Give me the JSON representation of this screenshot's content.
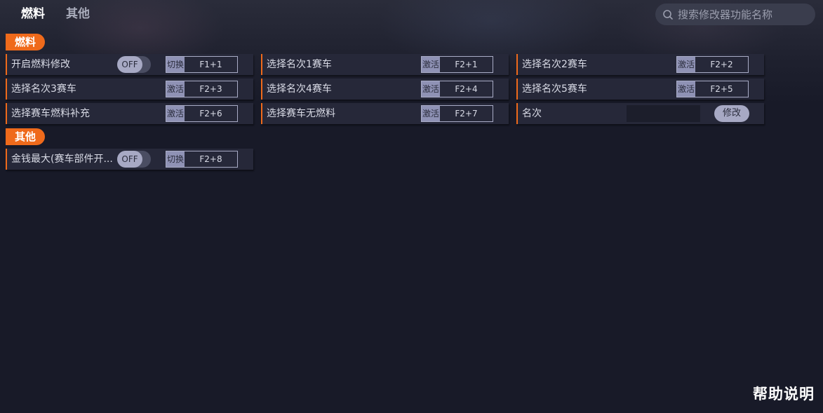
{
  "tabs": [
    {
      "label": "燃料"
    },
    {
      "label": "其他"
    }
  ],
  "search": {
    "placeholder": "搜索修改器功能名称"
  },
  "sections": {
    "fuel": {
      "title": "燃料",
      "rows": [
        {
          "label": "开启燃料修改",
          "kind": "toggle",
          "toggle": "OFF",
          "action": "切换",
          "hotkey": "F1+1"
        },
        {
          "label": "选择名次1赛车",
          "kind": "hotkey",
          "action": "激活",
          "hotkey": "F2+1"
        },
        {
          "label": "选择名次2赛车",
          "kind": "hotkey",
          "action": "激活",
          "hotkey": "F2+2"
        },
        {
          "label": "选择名次3赛车",
          "kind": "hotkey",
          "action": "激活",
          "hotkey": "F2+3"
        },
        {
          "label": "选择名次4赛车",
          "kind": "hotkey",
          "action": "激活",
          "hotkey": "F2+4"
        },
        {
          "label": "选择名次5赛车",
          "kind": "hotkey",
          "action": "激活",
          "hotkey": "F2+5"
        },
        {
          "label": "选择赛车燃料补充",
          "kind": "hotkey",
          "action": "激活",
          "hotkey": "F2+6"
        },
        {
          "label": "选择赛车无燃料",
          "kind": "hotkey",
          "action": "激活",
          "hotkey": "F2+7"
        },
        {
          "label": "名次",
          "kind": "input",
          "value": "",
          "button": "修改"
        }
      ]
    },
    "other": {
      "title": "其他",
      "rows": [
        {
          "label": "金钱最大(赛车部件开...",
          "kind": "toggle",
          "toggle": "OFF",
          "action": "切换",
          "hotkey": "F2+8"
        }
      ]
    }
  },
  "help_label": "帮助说明",
  "colors": {
    "accent": "#ef6a1b",
    "background": "#181a28",
    "row": "#262839",
    "button": "#a7a9c4"
  }
}
